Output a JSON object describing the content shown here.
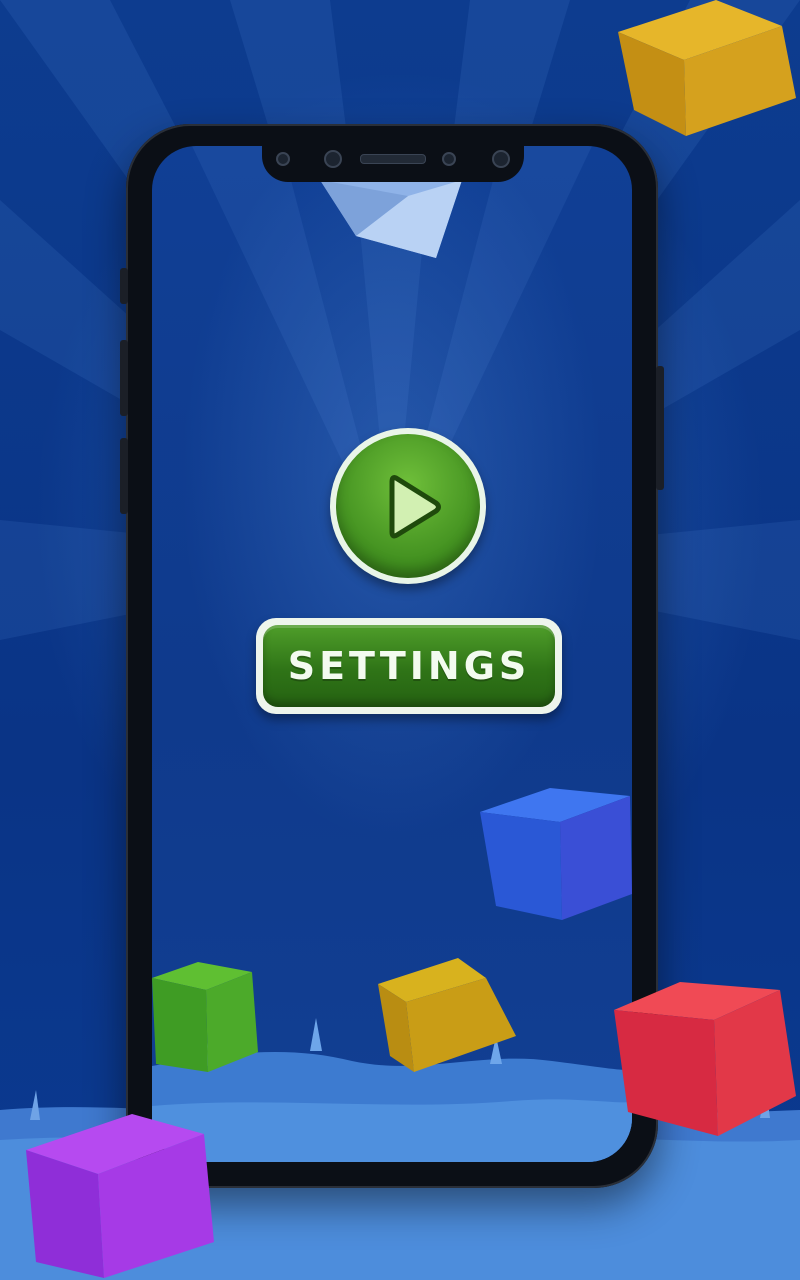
{
  "app": {
    "buttons": {
      "play": {
        "icon": "play-icon"
      },
      "settings": {
        "label": "SETTINGS"
      }
    }
  },
  "colors": {
    "background": "#0c3f95",
    "button_green": "#3f8d1e",
    "button_border": "#eef5ec",
    "ground": "#4a85d6"
  },
  "decor": {
    "cubes": [
      "white",
      "yellow",
      "blue",
      "green",
      "gold",
      "red",
      "purple"
    ]
  }
}
